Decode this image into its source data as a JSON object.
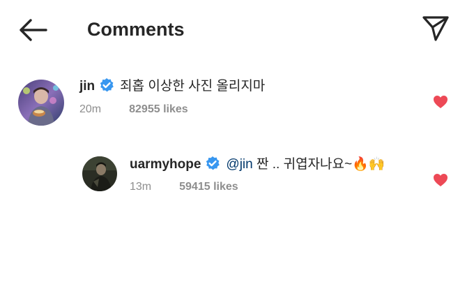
{
  "header": {
    "title": "Comments",
    "back_icon": "arrow-left-icon",
    "share_icon": "paper-plane-icon"
  },
  "comments": [
    {
      "username": "jin",
      "verified": true,
      "text": "죄홉 이상한 사진 올리지마",
      "time": "20m",
      "likes": "82955 likes",
      "liked": true
    }
  ],
  "replies": [
    {
      "username": "uarmyhope",
      "verified": true,
      "mention": "@jin",
      "text": " 짠 .. 귀엽자나요~🔥🙌",
      "time": "13m",
      "likes": "59415 likes",
      "liked": true
    }
  ],
  "colors": {
    "verified_blue": "#3897f0",
    "heart_red": "#ed4956",
    "mention_blue": "#00376b",
    "meta_gray": "#8e8e8e"
  }
}
